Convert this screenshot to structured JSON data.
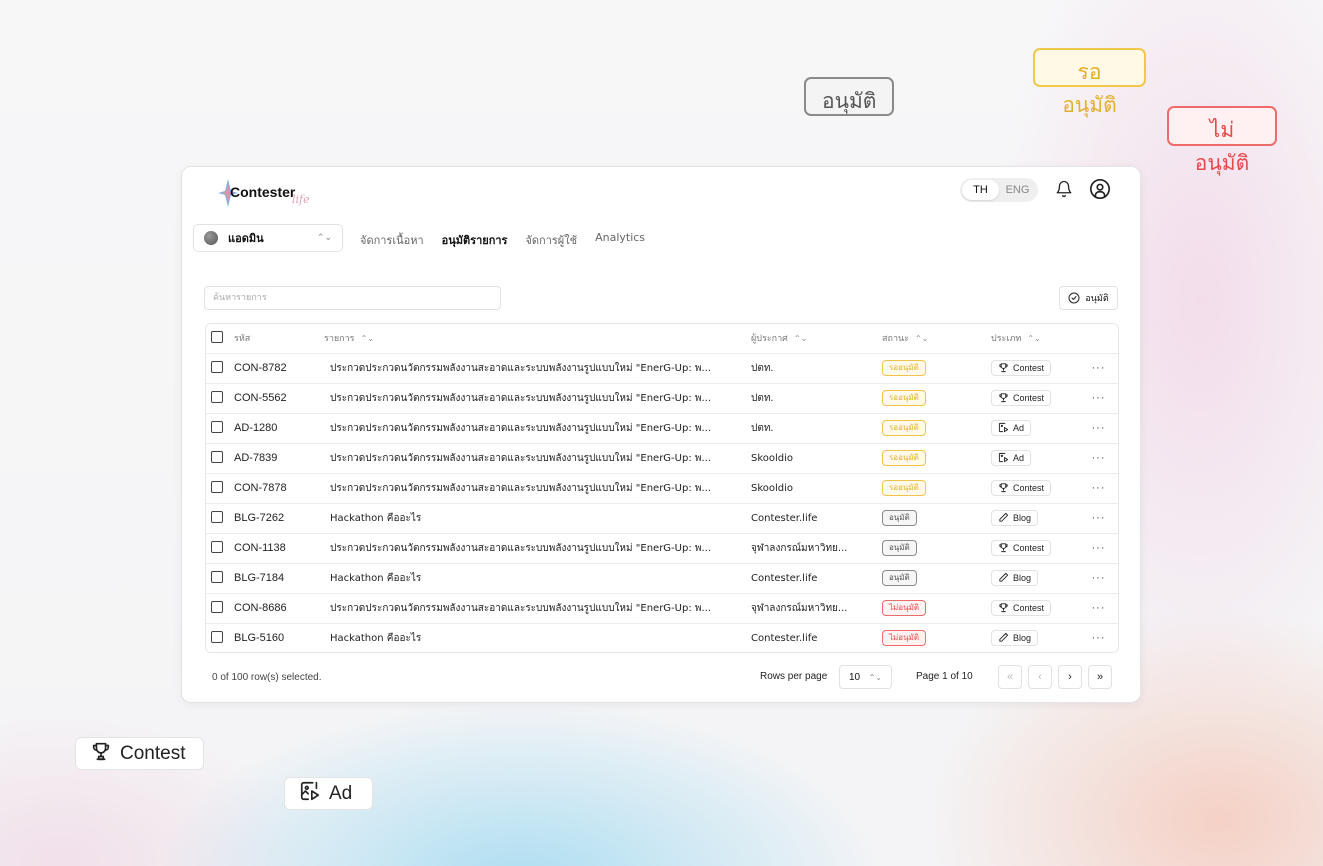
{
  "floating": {
    "approved_badge": "อนุมัติ",
    "pending_badge": "รออนุมัติ",
    "rejected_badge": "ไม่อนุมัติ",
    "contest_chip": "Contest",
    "ad_chip": "Ad"
  },
  "header": {
    "logo_text": "Contester",
    "logo_sub": "life",
    "lang_th": "TH",
    "lang_en": "ENG",
    "active_lang": "TH",
    "icons": [
      "bell-icon",
      "user-circle-icon"
    ]
  },
  "role_select": {
    "value": "แอดมิน"
  },
  "nav": {
    "items": [
      {
        "label": "จัดการเนื้อหา"
      },
      {
        "label": "อนุมัติรายการ"
      },
      {
        "label": "จัดการผู้ใช้"
      },
      {
        "label": "Analytics"
      }
    ],
    "active": "อนุมัติรายการ"
  },
  "search": {
    "placeholder": "ค้นหารายการ",
    "value": ""
  },
  "approve_button": {
    "label": "อนุมัติ"
  },
  "table": {
    "columns": {
      "code": "รหัส",
      "title": "รายการ",
      "org": "ผู้ประกาศ",
      "status": "สถานะ",
      "type": "ประเภท"
    },
    "rows": [
      {
        "code": "CON-8782",
        "title": "ประกวดประกวดนวัตกรรมพลังงานสะอาดและระบบพลังงานรูปแบบใหม่ \"EnerG-Up: พ...",
        "org": "ปตท.",
        "status": "รออนุมัติ",
        "status_kind": "pending",
        "type": "Contest",
        "type_icon": "trophy-icon"
      },
      {
        "code": "CON-5562",
        "title": "ประกวดประกวดนวัตกรรมพลังงานสะอาดและระบบพลังงานรูปแบบใหม่ \"EnerG-Up: พ...",
        "org": "ปตท.",
        "status": "รออนุมัติ",
        "status_kind": "pending",
        "type": "Contest",
        "type_icon": "trophy-icon"
      },
      {
        "code": "AD-1280",
        "title": "ประกวดประกวดนวัตกรรมพลังงานสะอาดและระบบพลังงานรูปแบบใหม่ \"EnerG-Up: พ...",
        "org": "ปตท.",
        "status": "รออนุมัติ",
        "status_kind": "pending",
        "type": "Ad",
        "type_icon": "image-play-icon"
      },
      {
        "code": "AD-7839",
        "title": "ประกวดประกวดนวัตกรรมพลังงานสะอาดและระบบพลังงานรูปแบบใหม่ \"EnerG-Up: พ...",
        "org": "Skooldio",
        "status": "รออนุมัติ",
        "status_kind": "pending",
        "type": "Ad",
        "type_icon": "image-play-icon"
      },
      {
        "code": "CON-7878",
        "title": "ประกวดประกวดนวัตกรรมพลังงานสะอาดและระบบพลังงานรูปแบบใหม่ \"EnerG-Up: พ...",
        "org": "Skooldio",
        "status": "รออนุมัติ",
        "status_kind": "pending",
        "type": "Contest",
        "type_icon": "trophy-icon"
      },
      {
        "code": "BLG-7262",
        "title": "Hackathon คืออะไร",
        "org": "Contester.life",
        "status": "อนุมัติ",
        "status_kind": "approved",
        "type": "Blog",
        "type_icon": "pencil-icon"
      },
      {
        "code": "CON-1138",
        "title": "ประกวดประกวดนวัตกรรมพลังงานสะอาดและระบบพลังงานรูปแบบใหม่ \"EnerG-Up: พ...",
        "org": "จุฬาลงกรณ์มหาวิทย...",
        "status": "อนุมัติ",
        "status_kind": "approved",
        "type": "Contest",
        "type_icon": "trophy-icon"
      },
      {
        "code": "BLG-7184",
        "title": "Hackathon คืออะไร",
        "org": "Contester.life",
        "status": "อนุมัติ",
        "status_kind": "approved",
        "type": "Blog",
        "type_icon": "pencil-icon"
      },
      {
        "code": "CON-8686",
        "title": "ประกวดประกวดนวัตกรรมพลังงานสะอาดและระบบพลังงานรูปแบบใหม่ \"EnerG-Up: พ...",
        "org": "จุฬาลงกรณ์มหาวิทย...",
        "status": "ไม่อนุมัติ",
        "status_kind": "rejected",
        "type": "Contest",
        "type_icon": "trophy-icon"
      },
      {
        "code": "BLG-5160",
        "title": "Hackathon คืออะไร",
        "org": "Contester.life",
        "status": "ไม่อนุมัติ",
        "status_kind": "rejected",
        "type": "Blog",
        "type_icon": "pencil-icon"
      }
    ]
  },
  "footer": {
    "selected_text": "0 of 100 row(s) selected.",
    "rows_per_page_label": "Rows per page",
    "rows_per_page_value": "10",
    "page_info": "Page 1 of 10"
  },
  "colors": {
    "pending": "#e3b02a",
    "approved": "#555555",
    "rejected": "#e44a4a"
  }
}
